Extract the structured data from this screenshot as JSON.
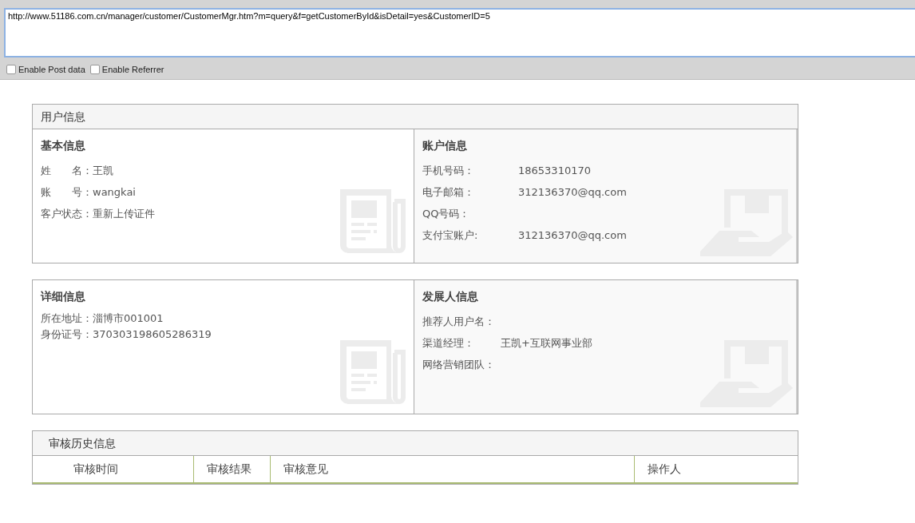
{
  "address_bar": {
    "url": "http://www.51186.com.cn/manager/customer/CustomerMgr.htm?m=query&f=getCustomerById&isDetail=yes&CustomerID=5",
    "options": [
      {
        "label": "Enable Post data",
        "checked": false
      },
      {
        "label": "Enable Referrer",
        "checked": false
      }
    ]
  },
  "panels": [
    {
      "title": "用户信息",
      "columns": [
        {
          "heading": "基本信息",
          "kind": "inline",
          "rows": [
            {
              "label": "姓　　名：",
              "value": "王凯"
            },
            {
              "label": "账　　号：",
              "value": "wangkai"
            },
            {
              "label": "客户状态：",
              "value": "重新上传证件"
            }
          ]
        },
        {
          "heading": "账户信息",
          "kind": "columns",
          "rows": [
            {
              "label": "手机号码：",
              "value": "18653310170"
            },
            {
              "label": "电子邮箱：",
              "value": "312136370@qq.com"
            },
            {
              "label": "QQ号码："
            },
            {
              "label": "支付宝账户:",
              "value": "312136370@qq.com"
            }
          ]
        }
      ]
    },
    {
      "columns": [
        {
          "heading": "详细信息",
          "kind": "inline",
          "rows": [
            {
              "label": "所在地址：",
              "value": "淄博市001001"
            },
            {
              "label": "身份证号：",
              "value": "370303198605286319"
            }
          ]
        },
        {
          "heading": "发展人信息",
          "kind": "spaced",
          "rows": [
            {
              "label": "推荐人用户名："
            },
            {
              "label": "渠道经理：",
              "value": "王凯+互联网事业部"
            },
            {
              "label": "网络营销团队："
            }
          ]
        }
      ]
    }
  ],
  "audit_history": {
    "title": "审核历史信息",
    "columns": [
      "审核时间",
      "审核结果",
      "审核意见",
      "操作人"
    ]
  }
}
